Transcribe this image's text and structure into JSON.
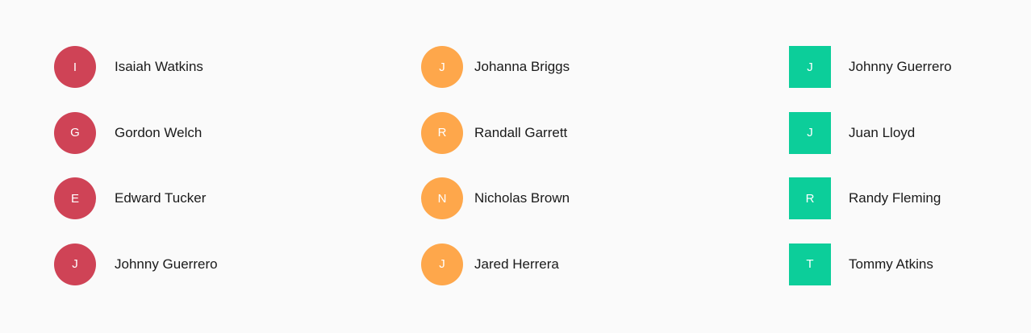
{
  "columns": [
    {
      "shape": "circle",
      "color": "#cf4356",
      "users": [
        {
          "initial": "I",
          "name": "Isaiah Watkins"
        },
        {
          "initial": "G",
          "name": "Gordon Welch"
        },
        {
          "initial": "E",
          "name": "Edward Tucker"
        },
        {
          "initial": "J",
          "name": "Johnny Guerrero"
        }
      ]
    },
    {
      "shape": "circle",
      "color": "#fea74b",
      "users": [
        {
          "initial": "J",
          "name": "Johanna Briggs"
        },
        {
          "initial": "R",
          "name": "Randall Garrett"
        },
        {
          "initial": "N",
          "name": "Nicholas Brown"
        },
        {
          "initial": "J",
          "name": "Jared Herrera"
        }
      ]
    },
    {
      "shape": "square",
      "color": "#0cce9a",
      "users": [
        {
          "initial": "J",
          "name": "Johnny Guerrero"
        },
        {
          "initial": "J",
          "name": "Juan Lloyd"
        },
        {
          "initial": "R",
          "name": "Randy Fleming"
        },
        {
          "initial": "T",
          "name": "Tommy Atkins"
        }
      ]
    }
  ]
}
